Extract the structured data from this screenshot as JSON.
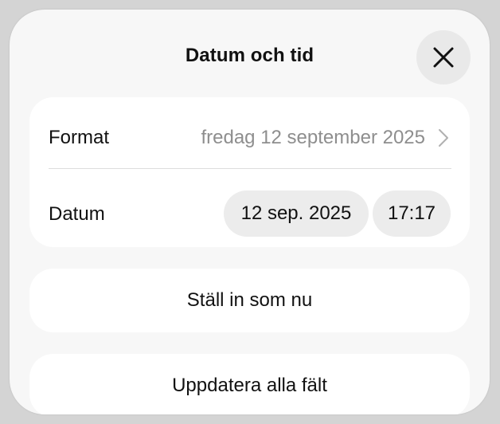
{
  "dialog": {
    "title": "Datum och tid",
    "close_icon": "close-icon"
  },
  "settings": {
    "format": {
      "label": "Format",
      "value": "fredag 12 september 2025",
      "icon": "chevron-right-icon"
    },
    "date": {
      "label": "Datum",
      "date_value": "12 sep. 2025",
      "time_value": "17:17"
    }
  },
  "actions": {
    "set_now_label": "Ställ in som nu",
    "update_all_label": "Uppdatera alla fält"
  },
  "colors": {
    "sheet_background": "#f7f7f7",
    "card_background": "#ffffff",
    "pill_background": "#ececec",
    "secondary_text": "#8e8e8e"
  }
}
